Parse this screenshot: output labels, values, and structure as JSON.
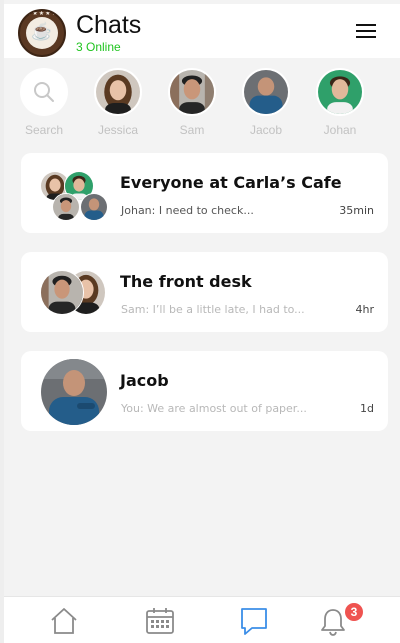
{
  "header": {
    "title": "Chats",
    "online_status": "3 Online",
    "online_color": "#1fc41f"
  },
  "stories": [
    {
      "label": "Search",
      "icon": "search-icon"
    },
    {
      "label": "Jessica"
    },
    {
      "label": "Sam"
    },
    {
      "label": "Jacob"
    },
    {
      "label": "Johan"
    }
  ],
  "chats": [
    {
      "name": "Everyone at Carla’s Cafe",
      "preview": "Johan: I need to check...",
      "time": "35min"
    },
    {
      "name": "The front desk",
      "preview": "Sam: I’ll be a little late, I had to...",
      "time": "4hr"
    },
    {
      "name": "Jacob",
      "preview": "You: We are almost out of paper...",
      "time": "1d"
    }
  ],
  "nav": {
    "items": [
      "home-icon",
      "calendar-icon",
      "chat-icon",
      "bell-icon"
    ],
    "active": "chat-icon",
    "notification_count": "3",
    "accent": "#3b8ee8",
    "badge_color": "#ef5350"
  }
}
